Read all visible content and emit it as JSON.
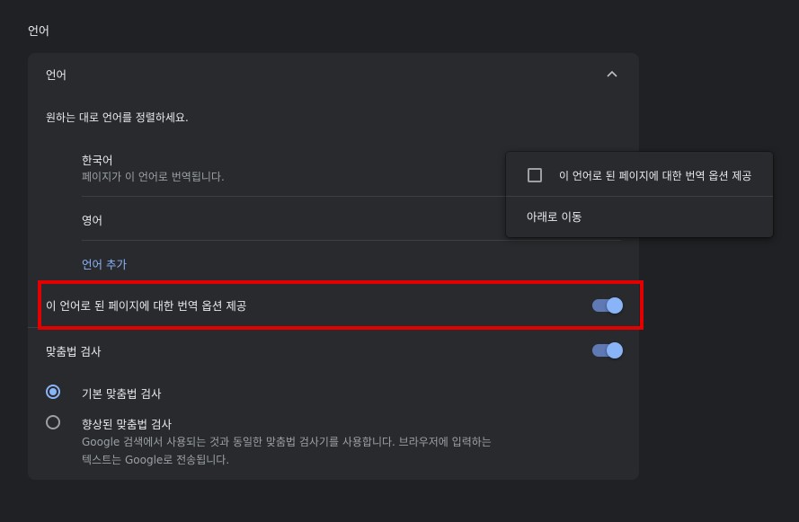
{
  "section_title": "언어",
  "card": {
    "header_label": "언어",
    "description": "원하는 대로 언어를 정렬하세요.",
    "languages": [
      {
        "name": "한국어",
        "subtitle": "페이지가 이 언어로 번역됩니다."
      },
      {
        "name": "영어"
      }
    ],
    "add_language_label": "언어 추가",
    "translate_offer_label": "이 언어로 된 페이지에 대한 번역 옵션 제공",
    "translate_offer_on": true,
    "spellcheck_label": "맞춤법 검사",
    "spellcheck_on": true,
    "spellcheck_options": [
      {
        "label": "기본 맞춤법 검사",
        "selected": true
      },
      {
        "label": "향상된 맞춤법 검사",
        "description": "Google 검색에서 사용되는 것과 동일한 맞춤법 검사기를 사용합니다. 브라우저에 입력하는 텍스트는 Google로 전송됩니다.",
        "selected": false
      }
    ]
  },
  "context_menu": {
    "item_checkbox_label": "이 언어로 된 페이지에 대한 번역 옵션 제공",
    "item_checkbox_checked": false,
    "item_move_down": "아래로 이동"
  },
  "colors": {
    "background": "#202124",
    "card": "#292a2d",
    "accent": "#8ab4f8",
    "highlight": "#e30000"
  }
}
